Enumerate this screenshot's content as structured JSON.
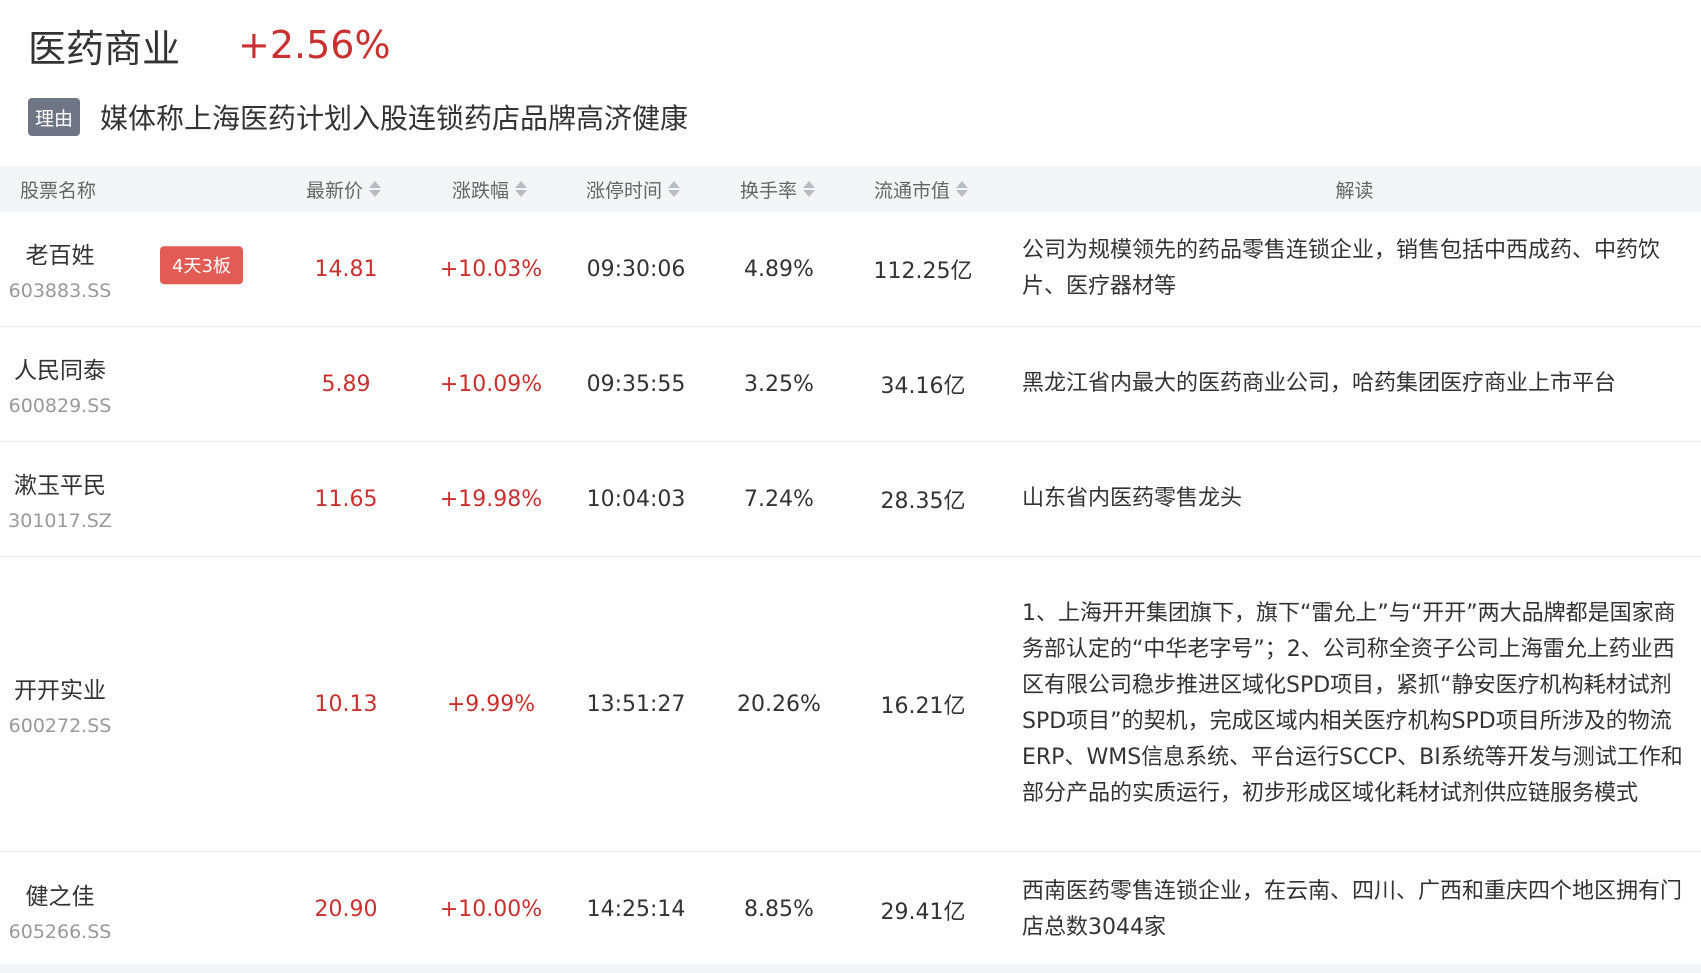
{
  "header": {
    "sector_name": "医药商业",
    "sector_change": "+2.56%"
  },
  "reason": {
    "badge": "理由",
    "text": "媒体称上海医药计划入股连锁药店品牌高济健康"
  },
  "table": {
    "columns": {
      "name": "股票名称",
      "price": "最新价",
      "change": "涨跌幅",
      "limit_time": "涨停时间",
      "turnover": "换手率",
      "market_cap": "流通市值",
      "interpretation": "解读"
    },
    "rows": [
      {
        "name": "老百姓",
        "code": "603883.SS",
        "tag": "4天3板",
        "price": "14.81",
        "change": "+10.03%",
        "limit_time": "09:30:06",
        "turnover": "4.89%",
        "market_cap": "112.25亿",
        "desc": "公司为规模领先的药品零售连锁企业，销售包括中西成药、中药饮片、医疗器材等"
      },
      {
        "name": "人民同泰",
        "code": "600829.SS",
        "tag": "",
        "price": "5.89",
        "change": "+10.09%",
        "limit_time": "09:35:55",
        "turnover": "3.25%",
        "market_cap": "34.16亿",
        "desc": "黑龙江省内最大的医药商业公司，哈药集团医疗商业上市平台"
      },
      {
        "name": "漱玉平民",
        "code": "301017.SZ",
        "tag": "",
        "price": "11.65",
        "change": "+19.98%",
        "limit_time": "10:04:03",
        "turnover": "7.24%",
        "market_cap": "28.35亿",
        "desc": "山东省内医药零售龙头"
      },
      {
        "name": "开开实业",
        "code": "600272.SS",
        "tag": "",
        "price": "10.13",
        "change": "+9.99%",
        "limit_time": "13:51:27",
        "turnover": "20.26%",
        "market_cap": "16.21亿",
        "desc": "1、上海开开集团旗下，旗下“雷允上”与“开开”两大品牌都是国家商务部认定的“中华老字号”；2、公司称全资子公司上海雷允上药业西区有限公司稳步推进区域化SPD项目，紧抓“静安医疗机构耗材试剂SPD项目”的契机，完成区域内相关医疗机构SPD项目所涉及的物流ERP、WMS信息系统、平台运行SCCP、BI系统等开发与测试工作和部分产品的实质运行，初步形成区域化耗材试剂供应链服务模式"
      },
      {
        "name": "健之佳",
        "code": "605266.SS",
        "tag": "",
        "price": "20.90",
        "change": "+10.00%",
        "limit_time": "14:25:14",
        "turnover": "8.85%",
        "market_cap": "29.41亿",
        "desc": "西南医药零售连锁企业，在云南、四川、广西和重庆四个地区拥有门店总数3044家"
      }
    ]
  },
  "colors": {
    "up_red": "#c8312f",
    "tag_red": "#e25c55",
    "badge_gray": "#6f7585",
    "header_bg": "#f4f5f7"
  }
}
